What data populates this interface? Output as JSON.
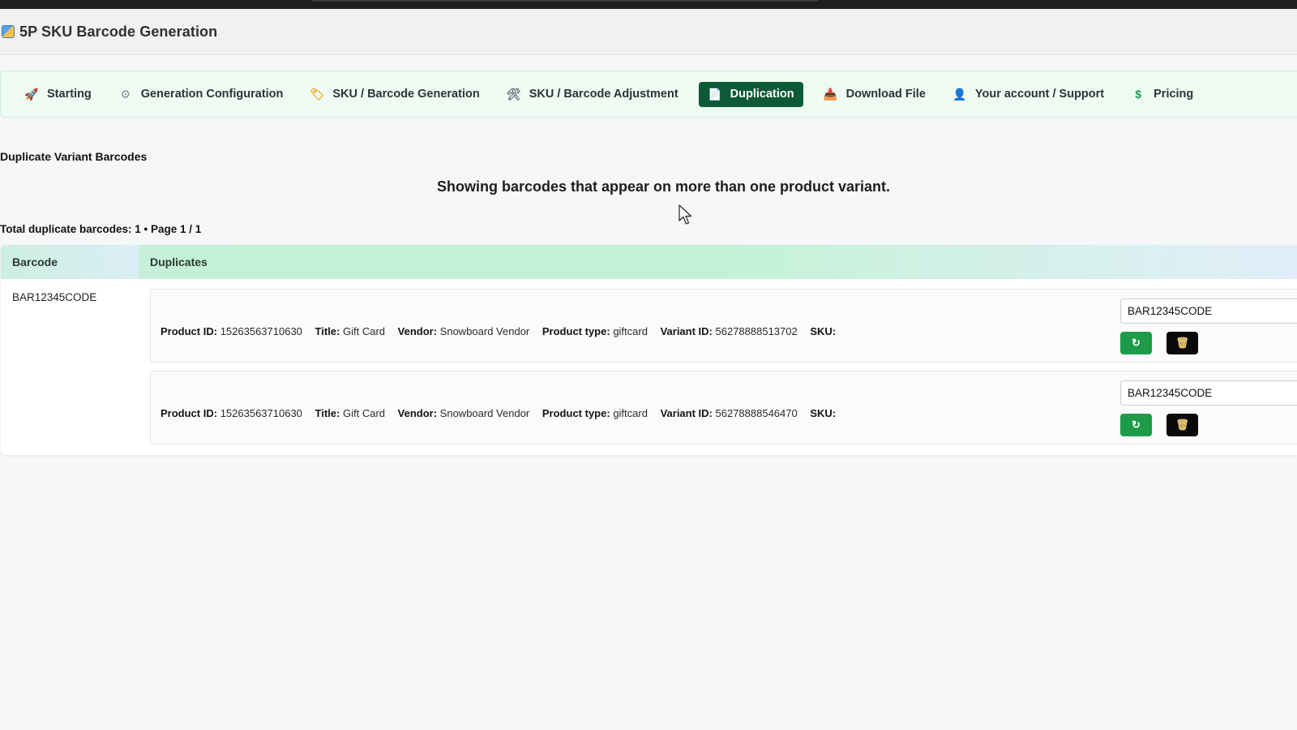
{
  "app": {
    "title": "5P SKU Barcode Generation"
  },
  "nav": {
    "items": [
      {
        "label": "Starting",
        "icon": "rocket-icon",
        "glyph": "🚀"
      },
      {
        "label": "Generation Configuration",
        "icon": "gear-icon",
        "glyph": "⚙"
      },
      {
        "label": "SKU / Barcode Generation",
        "icon": "tag-icon",
        "glyph": "🏷"
      },
      {
        "label": "SKU / Barcode Adjustment",
        "icon": "tools-icon",
        "glyph": "🛠"
      },
      {
        "label": "Duplication",
        "icon": "document-icon",
        "glyph": "📄",
        "active": true
      },
      {
        "label": "Download File",
        "icon": "download-icon",
        "glyph": "📥"
      },
      {
        "label": "Your account / Support",
        "icon": "user-icon",
        "glyph": "👤"
      },
      {
        "label": "Pricing",
        "icon": "dollar-icon",
        "glyph": "$"
      }
    ]
  },
  "page": {
    "section_title": "Duplicate Variant Barcodes",
    "info_text": "Showing barcodes that appear on more than one product variant.",
    "totals": "Total duplicate barcodes: 1 • Page 1 / 1"
  },
  "table": {
    "headers": {
      "barcode": "Barcode",
      "duplicates": "Duplicates"
    },
    "rows": [
      {
        "barcode": "BAR12345CODE",
        "duplicates": [
          {
            "product_id_label": "Product ID:",
            "product_id": "15263563710630",
            "title_label": "Title:",
            "title": "Gift Card",
            "vendor_label": "Vendor:",
            "vendor": "Snowboard Vendor",
            "product_type_label": "Product type:",
            "product_type": "giftcard",
            "variant_id_label": "Variant ID:",
            "variant_id": "56278888513702",
            "sku_label": "SKU:",
            "sku": "",
            "barcode_value": "BAR12345CODE",
            "refresh_glyph": "↻",
            "delete_glyph": "🗑"
          },
          {
            "product_id_label": "Product ID:",
            "product_id": "15263563710630",
            "title_label": "Title:",
            "title": "Gift Card",
            "vendor_label": "Vendor:",
            "vendor": "Snowboard Vendor",
            "product_type_label": "Product type:",
            "product_type": "giftcard",
            "variant_id_label": "Variant ID:",
            "variant_id": "56278888546470",
            "sku_label": "SKU:",
            "sku": "",
            "barcode_value": "BAR12345CODE",
            "refresh_glyph": "↻",
            "delete_glyph": "🗑"
          }
        ]
      }
    ]
  },
  "colors": {
    "active_tab_bg": "#0e5a36",
    "nav_bg": "#eefbf3",
    "header_green": "#c3f2d6",
    "refresh_button": "#1e9b48",
    "delete_button": "#0a0a0a"
  }
}
